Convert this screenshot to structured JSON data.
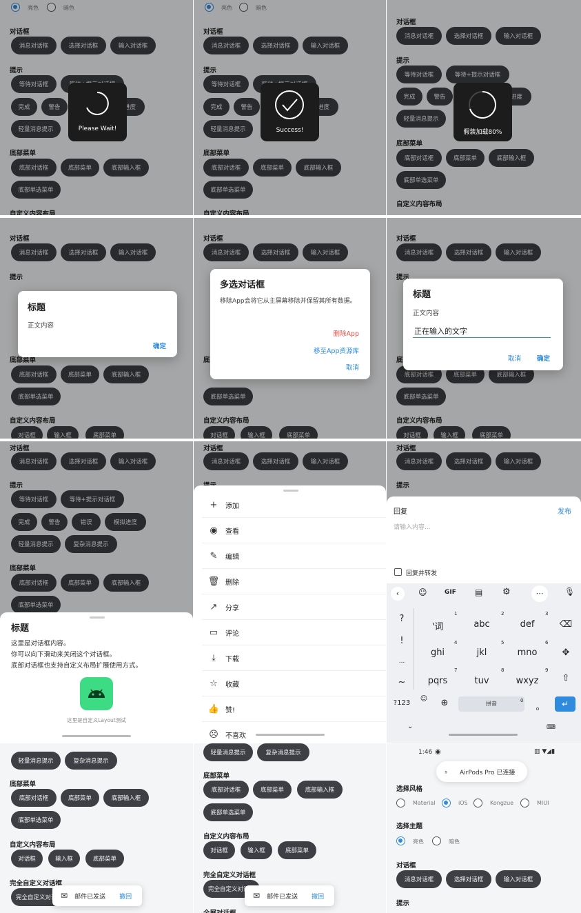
{
  "labels": {
    "theme_light": "亮色",
    "theme_dark": "暗色",
    "sec_dialog": "对话框",
    "sec_tip": "提示",
    "sec_bottom": "底部菜单",
    "sec_custom": "自定义内容布局",
    "sec_full_custom": "完全自定义对话框",
    "sec_fullscreen": "全屏对话框",
    "sec_style": "选择风格",
    "sec_theme": "选择主题"
  },
  "buttons": {
    "msg": "消息对话框",
    "select": "选择对话框",
    "input": "输入对话框",
    "wait": "等待对话框",
    "wait_tip": "等待+提示对话框",
    "done": "完成",
    "warn": "警告",
    "error": "错误",
    "progress": "模拟进度",
    "light_tip": "轻量消息提示",
    "complex_tip": "复杂消息提示",
    "bottom_dialog": "底部对话框",
    "bottom_menu": "底部菜单",
    "bottom_input": "底部输入框",
    "bottom_single": "底部单选菜单",
    "c_dialog": "对话框",
    "c_input": "输入框",
    "c_bottom": "底部菜单",
    "full_custom": "完全自定义对话框"
  },
  "cells": {
    "wait": {
      "text": "Please Wait!"
    },
    "success": {
      "text": "Success!"
    },
    "loading": {
      "text": "假装加载80%"
    },
    "msg_dialog": {
      "title": "标题",
      "body": "正文内容",
      "ok": "确定"
    },
    "multi_dialog": {
      "title": "多选对话框",
      "body": "移除App会将它从主屏幕移除并保留其所有数据。",
      "opt_delete": "删除App",
      "opt_move": "移至App资源库",
      "opt_cancel": "取消"
    },
    "input_dialog": {
      "title": "标题",
      "body": "正文内容",
      "value": "正在输入的文字",
      "cancel": "取消",
      "ok": "确定"
    },
    "bottom_dialog": {
      "title": "标题",
      "line1": "这里是对话框内容。",
      "line2": "你可以向下滑动来关闭这个对话框。",
      "line3": "底部对话框也支持自定义布局扩展使用方式。",
      "caption": "这里是自定义Layout测试"
    },
    "menu": {
      "items": [
        "添加",
        "查看",
        "编辑",
        "删除",
        "分享",
        "评论",
        "下载",
        "收藏",
        "赞!",
        "不喜欢"
      ]
    },
    "reply": {
      "title": "回复",
      "publish": "发布",
      "placeholder": "请输入内容...",
      "forward": "回复并转发"
    },
    "keyboard": {
      "row1": [
        "?",
        "'词",
        "abc",
        "def"
      ],
      "row2": [
        "!",
        "ghi",
        "jkl",
        "mno"
      ],
      "row3": [
        "...",
        "pqrs",
        "tuv",
        "wxyz"
      ],
      "row4": [
        "?123",
        "拼音"
      ],
      "toolbar": [
        "GIF"
      ],
      "nums": [
        "1",
        "2",
        "3",
        "4",
        "5",
        "6",
        "7",
        "8",
        "9",
        "0"
      ]
    },
    "toast": {
      "text": "邮件已发送",
      "undo": "撤回"
    },
    "notify": {
      "time": "1:46",
      "text": "AirPods Pro 已连接"
    },
    "styles": [
      "Material",
      "iOS",
      "Kongzue",
      "MIUI"
    ]
  },
  "colors": {
    "accent": "#2f8bde",
    "danger": "#e0534a",
    "button": "#3d3f45"
  }
}
